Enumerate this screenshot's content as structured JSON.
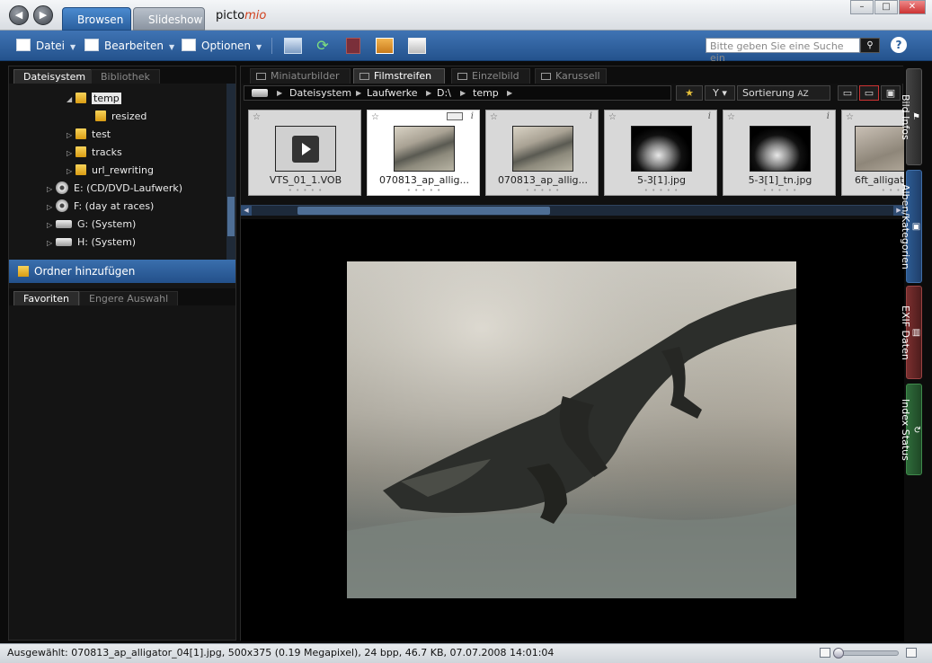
{
  "app": {
    "logo_prefix": "picto",
    "logo_accent": "mio",
    "tabs": [
      {
        "label": "Browsen",
        "active": true
      },
      {
        "label": "Slideshow",
        "active": false
      }
    ]
  },
  "window_controls": {
    "minimize": "–",
    "maximize": "□",
    "close": "✕"
  },
  "toolbar": {
    "menus": [
      {
        "label": "Datei"
      },
      {
        "label": "Bearbeiten"
      },
      {
        "label": "Optionen"
      }
    ],
    "search_placeholder": "Bitte geben Sie eine Suche ein",
    "help": "?"
  },
  "left_panel": {
    "tabs": [
      {
        "label": "Dateisystem",
        "active": true
      },
      {
        "label": "Bibliothek",
        "active": false
      }
    ],
    "tree": [
      {
        "label": "temp",
        "type": "folder",
        "expander": "◢",
        "selected": true
      },
      {
        "label": "resized",
        "type": "folder",
        "expander": ""
      },
      {
        "label": "test",
        "type": "folder",
        "expander": "▷"
      },
      {
        "label": "tracks",
        "type": "folder",
        "expander": "▷"
      },
      {
        "label": "url_rewriting",
        "type": "folder",
        "expander": "▷"
      },
      {
        "label": "E: (CD/DVD-Laufwerk)",
        "type": "disc",
        "expander": "▷"
      },
      {
        "label": "F: (day at races)",
        "type": "disc",
        "expander": "▷"
      },
      {
        "label": "G: (System)",
        "type": "drive",
        "expander": "▷"
      },
      {
        "label": "H: (System)",
        "type": "drive",
        "expander": "▷"
      }
    ],
    "add_folder_label": "Ordner hinzufügen",
    "bottom_tabs": [
      {
        "label": "Favoriten",
        "active": true
      },
      {
        "label": "Engere Auswahl",
        "active": false
      }
    ]
  },
  "view_tabs": [
    {
      "label": "Miniaturbilder",
      "active": false
    },
    {
      "label": "Filmstreifen",
      "active": true
    },
    {
      "label": "Einzelbild",
      "active": false
    },
    {
      "label": "Karussell",
      "active": false
    }
  ],
  "breadcrumb": [
    "Dateisystem",
    "Laufwerke",
    "D:\\",
    "temp"
  ],
  "controls": {
    "filter_label": "Y",
    "sort_label": "Sortierung",
    "sort_icon": "AZ"
  },
  "thumbnails": [
    {
      "name": "VTS_01_1.VOB",
      "kind": "video",
      "selected": false
    },
    {
      "name": "070813_ap_allig...",
      "kind": "gator",
      "selected": true
    },
    {
      "name": "070813_ap_allig...",
      "kind": "gator",
      "selected": false
    },
    {
      "name": "5-3[1].jpg",
      "kind": "dark",
      "selected": false
    },
    {
      "name": "5-3[1]_tn.jpg",
      "kind": "dark",
      "selected": false
    },
    {
      "name": "6ft_alligat",
      "kind": "partial",
      "selected": false
    }
  ],
  "thumb_glyphs": {
    "star": "☆",
    "info": "i",
    "dots": "• • • • •"
  },
  "side_tabs": [
    {
      "label": "Bild Infos",
      "glyph": "⚑"
    },
    {
      "label": "Alben/Kategorien",
      "glyph": "▣"
    },
    {
      "label": "EXIF Daten",
      "glyph": "▥"
    },
    {
      "label": "Index Status",
      "glyph": "↻"
    }
  ],
  "status": {
    "text": "Ausgewählt: 070813_ap_alligator_04[1].jpg, 500x375 (0.19 Megapixel), 24 bpp, 46.7 KB, 07.07.2008 14:01:04",
    "zoom_fraction": 0.0
  },
  "colors": {
    "accent": "#2a5f9e",
    "selected_folder_bg": "#e8e8e8",
    "exif": "#7a2f2f",
    "index": "#2f6b3a"
  }
}
